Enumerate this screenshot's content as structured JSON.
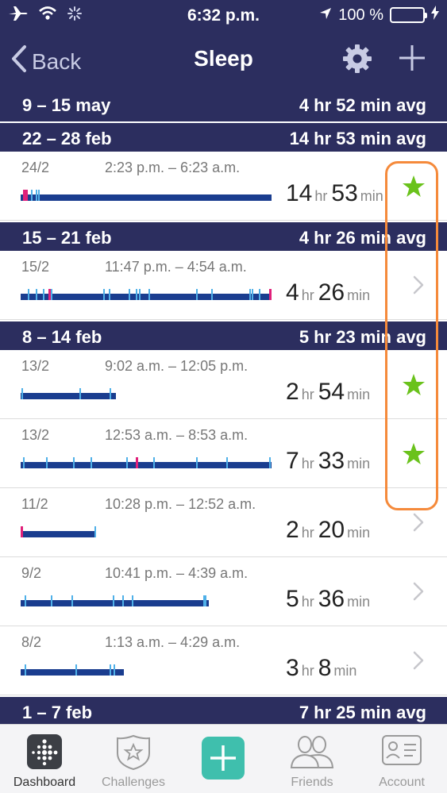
{
  "status_bar": {
    "time": "6:32 p.m.",
    "battery": "100 %",
    "icons": [
      "airplane-icon",
      "wifi-icon",
      "spinner-icon",
      "location-arrow-icon",
      "battery-icon",
      "charging-bolt-icon"
    ]
  },
  "nav": {
    "back_label": "Back",
    "title": "Sleep",
    "icons": [
      "chevron-left-icon",
      "gear-icon",
      "plus-icon"
    ]
  },
  "colors": {
    "header_bg": "#2c2e5f",
    "bar_main": "#1a3d8f",
    "bar_awake": "#4fb0e8",
    "bar_restless": "#e0207a",
    "star": "#6ac21c",
    "highlight": "#f58a3b",
    "tab_accent": "#3fbfad"
  },
  "weeks": [
    {
      "range": "9 – 15 may",
      "avg": "4 hr 52 min avg",
      "entries": []
    },
    {
      "range": "22 – 28 feb",
      "avg": "14 hr 53 min avg",
      "entries": [
        {
          "date": "24/2",
          "span": "2:23 p.m. – 6:23 a.m.",
          "hours": "14",
          "hr": "hr",
          "minutes": "53",
          "min": "min",
          "indicator": "star",
          "bar_fraction": 1.0,
          "awake_marks": [
            0.04,
            0.06,
            0.07
          ],
          "restless_marks": [
            0.01,
            0.02
          ]
        }
      ]
    },
    {
      "range": "15 – 21 feb",
      "avg": "4 hr 26 min avg",
      "entries": [
        {
          "date": "15/2",
          "span": "11:47 p.m. – 4:54 a.m.",
          "hours": "4",
          "hr": "hr",
          "minutes": "26",
          "min": "min",
          "indicator": "chevron",
          "bar_fraction": 1.0,
          "awake_marks": [
            0.03,
            0.06,
            0.09,
            0.12,
            0.33,
            0.35,
            0.43,
            0.46,
            0.47,
            0.51,
            0.7,
            0.76,
            0.91,
            0.92,
            0.95
          ],
          "restless_marks": [
            0.11,
            0.99
          ]
        }
      ]
    },
    {
      "range": "8 – 14 feb",
      "avg": "5 hr 23 min avg",
      "entries": [
        {
          "date": "13/2",
          "span": "9:02 a.m. – 12:05 p.m.",
          "hours": "2",
          "hr": "hr",
          "minutes": "54",
          "min": "min",
          "indicator": "star",
          "bar_fraction": 0.38,
          "awake_marks": [
            0.01,
            0.62,
            0.93
          ],
          "restless_marks": []
        },
        {
          "date": "13/2",
          "span": "12:53 a.m. – 8:53 a.m.",
          "hours": "7",
          "hr": "hr",
          "minutes": "33",
          "min": "min",
          "indicator": "star",
          "bar_fraction": 1.0,
          "awake_marks": [
            0.01,
            0.1,
            0.21,
            0.28,
            0.42,
            0.53,
            0.7,
            0.82,
            0.99
          ],
          "restless_marks": [
            0.46
          ]
        },
        {
          "date": "11/2",
          "span": "10:28 p.m. – 12:52 a.m.",
          "hours": "2",
          "hr": "hr",
          "minutes": "20",
          "min": "min",
          "indicator": "chevron",
          "bar_fraction": 0.3,
          "awake_marks": [
            0.98
          ],
          "restless_marks": [
            0.0
          ]
        },
        {
          "date": "9/2",
          "span": "10:41 p.m. – 4:39 a.m.",
          "hours": "5",
          "hr": "hr",
          "minutes": "36",
          "min": "min",
          "indicator": "chevron",
          "bar_fraction": 0.75,
          "awake_marks": [
            0.02,
            0.16,
            0.27,
            0.49,
            0.54,
            0.59,
            0.97,
            0.98
          ],
          "restless_marks": []
        },
        {
          "date": "8/2",
          "span": "1:13 a.m. – 4:29 a.m.",
          "hours": "3",
          "hr": "hr",
          "minutes": "8",
          "min": "min",
          "indicator": "chevron",
          "bar_fraction": 0.41,
          "awake_marks": [
            0.04,
            0.53,
            0.86,
            0.9
          ],
          "restless_marks": []
        }
      ]
    },
    {
      "range": "1 – 7 feb",
      "avg": "7 hr 25 min avg",
      "entries": []
    }
  ],
  "tabs": [
    {
      "label": "Dashboard",
      "icon": "fitbit-dots-icon",
      "active": true
    },
    {
      "label": "Challenges",
      "icon": "challenge-badge-icon",
      "active": false
    },
    {
      "label": "",
      "icon": "add-plus-icon",
      "active": false
    },
    {
      "label": "Friends",
      "icon": "friends-icon",
      "active": false
    },
    {
      "label": "Account",
      "icon": "account-card-icon",
      "active": false
    }
  ]
}
